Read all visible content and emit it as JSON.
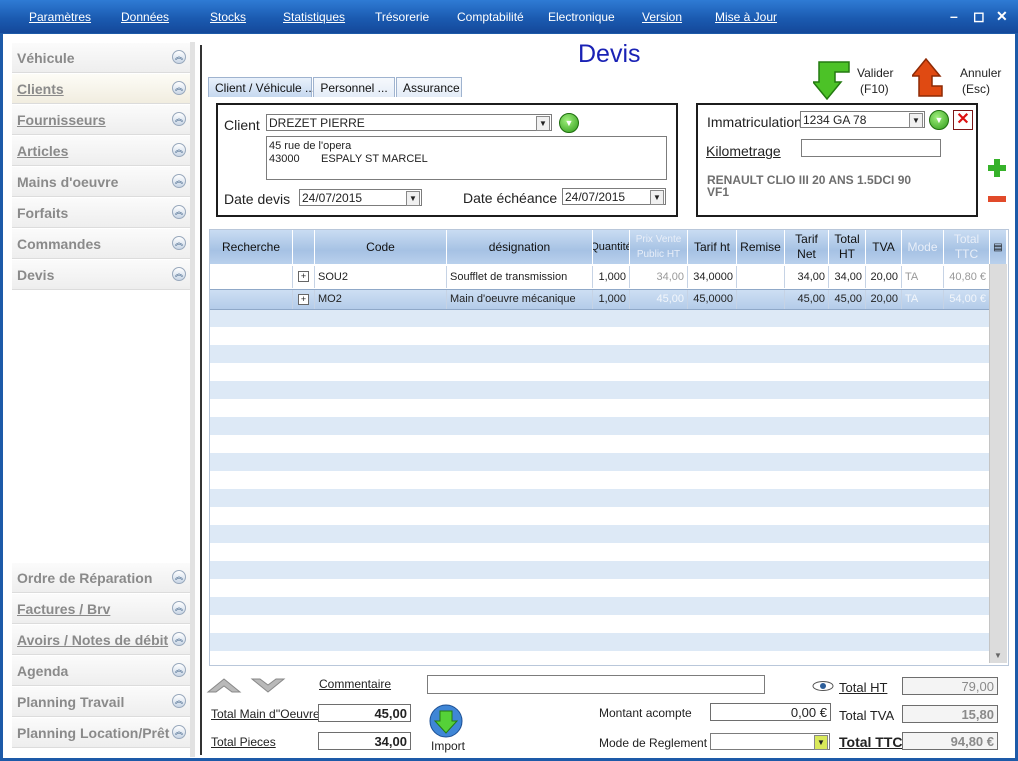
{
  "menu": [
    {
      "label": "Paramètres",
      "u": true
    },
    {
      "label": "Données",
      "u": true
    },
    {
      "label": "Stocks",
      "u": true
    },
    {
      "label": "Statistiques",
      "u": true
    },
    {
      "label": "Trésorerie",
      "u": false
    },
    {
      "label": "Comptabilité",
      "u": false
    },
    {
      "label": "Electronique",
      "u": false
    },
    {
      "label": "Version",
      "u": true
    },
    {
      "label": "Mise à Jour",
      "u": true
    }
  ],
  "window_controls": {
    "minimize": "–",
    "maximize": "◻",
    "close": "✕"
  },
  "sidebar": {
    "top_items": [
      "Véhicule",
      "Clients",
      "Fournisseurs",
      "Articles",
      "Mains d'oeuvre",
      "Forfaits",
      "Commandes",
      "Devis"
    ],
    "bottom_items": [
      "Ordre de Réparation",
      "Factures / Brv",
      "Avoirs / Notes de débit",
      "Agenda",
      "Planning Travail",
      "Planning Location/Prêt"
    ],
    "selected": "Clients"
  },
  "page_title": "Devis",
  "actions": {
    "valider": {
      "label": "Valider",
      "shortcut": "(F10)"
    },
    "annuler": {
      "label": "Annuler",
      "shortcut": "(Esc)"
    }
  },
  "tabs": [
    "Client / Véhicule ...",
    "Personnel ...",
    "Assurance"
  ],
  "client_panel": {
    "client_label": "Client",
    "client_value": "DREZET PIERRE",
    "address_line1": "45 rue de l'opera",
    "address_line2": "43000       ESPALY ST MARCEL",
    "date_devis_label": "Date devis",
    "date_devis_value": "24/07/2015",
    "date_echeance_label": "Date échéance",
    "date_echeance_value": "24/07/2015"
  },
  "vehicle_panel": {
    "immat_label": "Immatriculation",
    "immat_value": "1234 GA 78",
    "km_label": "Kilometrage",
    "km_value": "",
    "vehicle_desc": "RENAULT CLIO III 20 ANS 1.5DCI 90",
    "vehicle_sub": "VF1"
  },
  "grid": {
    "headers": [
      "Recherche",
      "",
      "Code",
      "désignation",
      "Quantité",
      "Prix Vente Public HT",
      "Tarif ht",
      "Remise",
      "Tarif Net",
      "Total HT",
      "TVA",
      "Mode",
      "Total TTC"
    ],
    "rows": [
      {
        "code": "SOU2",
        "designation": "Soufflet de transmission",
        "quantite": "1,000",
        "prix_public": "34,00",
        "tarif_ht": "34,0000",
        "remise": "",
        "tarif_net": "34,00",
        "total_ht": "34,00",
        "tva": "20,00",
        "mode": "TA",
        "total_ttc": "40,80 €"
      },
      {
        "code": "MO2",
        "designation": "Main d'oeuvre mécanique",
        "quantite": "1,000",
        "prix_public": "45,00",
        "tarif_ht": "45,0000",
        "remise": "",
        "tarif_net": "45,00",
        "total_ht": "45,00",
        "tva": "20,00",
        "mode": "TA",
        "total_ttc": "54,00 €"
      }
    ]
  },
  "bottom": {
    "commentaire_label": "Commentaire",
    "commentaire_value": "",
    "total_mo_label": "Total Main d''Oeuvre",
    "total_mo_value": "45,00",
    "total_pieces_label": "Total Pieces",
    "total_pieces_value": "34,00",
    "import_label": "Import",
    "acompte_label": "Montant acompte",
    "acompte_value": "0,00 €",
    "reglement_label": "Mode de Reglement :",
    "reglement_value": "",
    "total_ht_label": "Total HT",
    "total_ht_value": "79,00",
    "total_tva_label": "Total TVA",
    "total_tva_value": "15,80",
    "total_ttc_label": "Total TTC",
    "total_ttc_value": "94,80 €"
  },
  "colors": {
    "accent": "#1a22b5",
    "menubar": "#1b5bb1",
    "grid_header": "#b2cbea",
    "selected_row": "#d6e4f4"
  }
}
